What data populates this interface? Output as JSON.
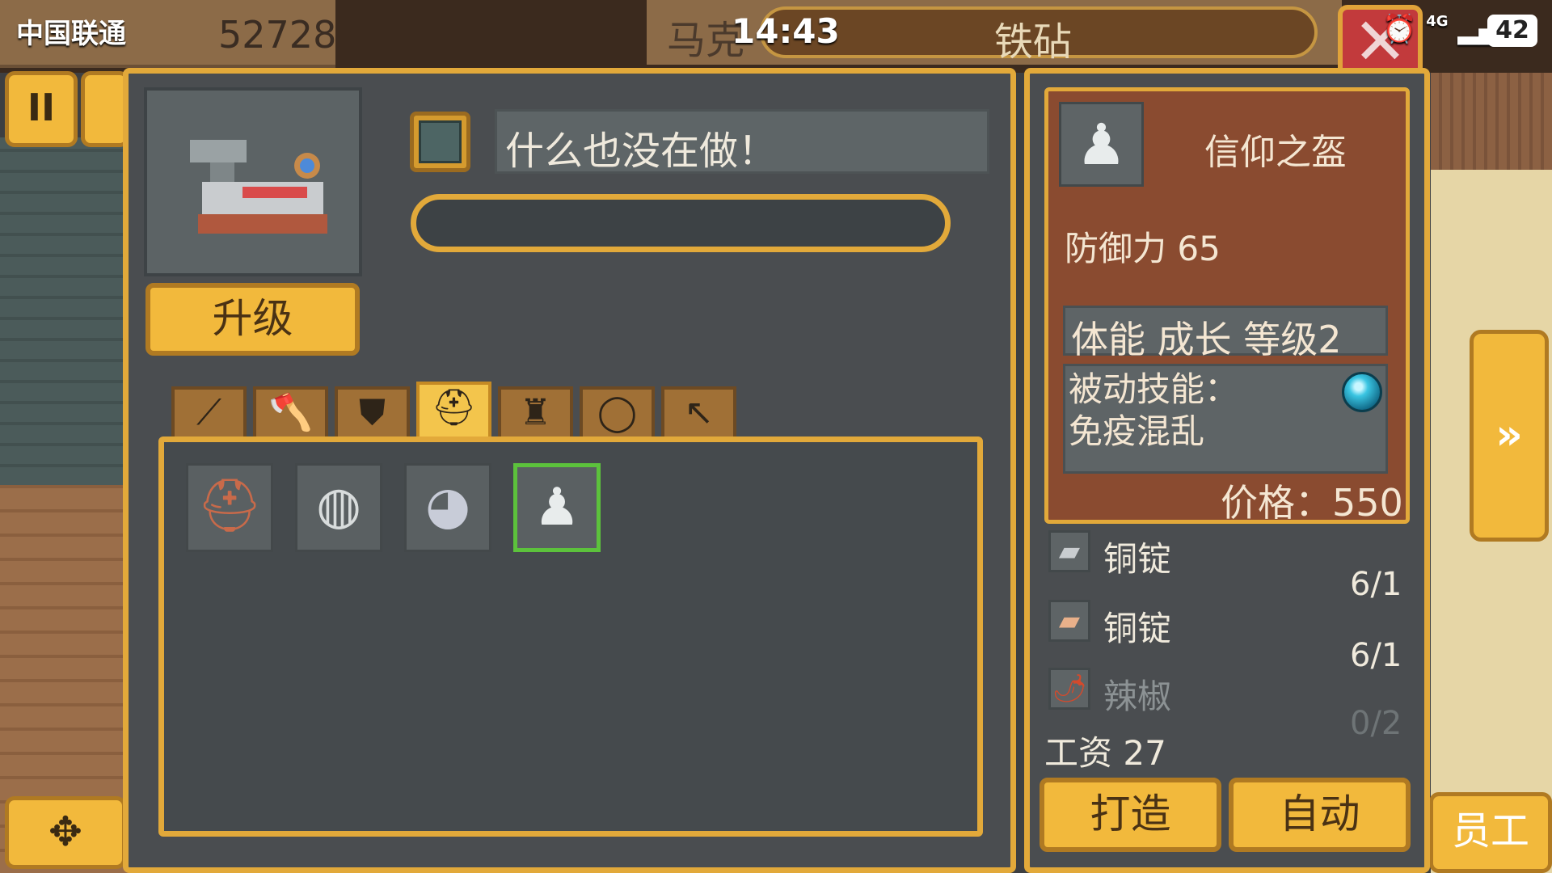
{
  "status_bar": {
    "carrier": "中国联通",
    "time": "14:43",
    "network": "4G",
    "battery": "42"
  },
  "top_bar": {
    "gold": "52728",
    "left_title_fragment": "马克",
    "title": "铁砧",
    "close_symbol": "✕"
  },
  "side": {
    "pause_symbol": "II",
    "move_symbol": "✥",
    "next_symbol": "»",
    "staff_label": "员工"
  },
  "workbench": {
    "upgrade_label": "升级",
    "status_text": "什么也没在做！",
    "progress": 0
  },
  "tabs": [
    {
      "icon": "sword-icon",
      "glyph": "⟋"
    },
    {
      "icon": "axe-icon",
      "glyph": "🪓"
    },
    {
      "icon": "shield-icon",
      "glyph": "⛊"
    },
    {
      "icon": "helmet-icon",
      "glyph": "⛑"
    },
    {
      "icon": "armor-icon",
      "glyph": "♜"
    },
    {
      "icon": "ring-icon",
      "glyph": "◯"
    },
    {
      "icon": "bow-icon",
      "glyph": "↖"
    }
  ],
  "active_tab": 3,
  "items": [
    {
      "icon": "leather-cap-icon",
      "glyph": "⛑",
      "color": "#c86a4a"
    },
    {
      "icon": "iron-helmet-icon",
      "glyph": "◍",
      "color": "#d8dcdc"
    },
    {
      "icon": "plumed-helmet-icon",
      "glyph": "◕",
      "color": "#c8ccd8"
    },
    {
      "icon": "faith-helm-icon",
      "glyph": "♟",
      "color": "#e8ecec"
    }
  ],
  "selected_item": 3,
  "detail": {
    "name": "信仰之盔",
    "defense": "防御力 65",
    "trait": "体能 成长 等级2",
    "passive_label": "被动技能：",
    "passive_value": "免疫混乱",
    "price": "价格：550"
  },
  "materials": [
    {
      "icon": "iron-ingot-icon",
      "glyph": "▰",
      "name": "铜锭",
      "count": "6/1",
      "dim": false
    },
    {
      "icon": "copper-ingot-icon",
      "glyph": "▰",
      "name": "铜锭",
      "count": "6/1",
      "dim": false
    },
    {
      "icon": "chili-icon",
      "glyph": "🌶",
      "name": "辣椒",
      "count": "0/2",
      "dim": true
    }
  ],
  "wage": "工资 27",
  "actions": {
    "forge_label": "打造",
    "auto_label": "自动"
  }
}
